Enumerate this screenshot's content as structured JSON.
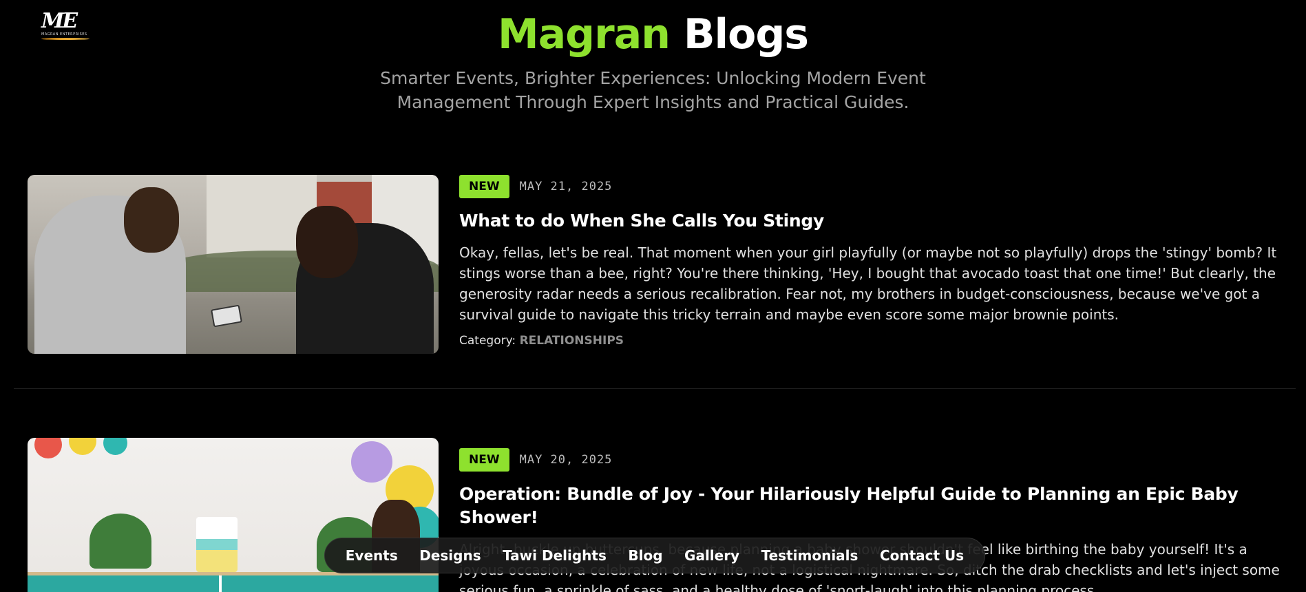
{
  "brand": {
    "logo_mark": "ME",
    "logo_subtext": "MAGRAN ENTERPRISES",
    "title_accent": "Magran",
    "title_rest": "Blogs",
    "tagline": "Smarter Events, Brighter Experiences: Unlocking Modern Event Management Through Expert Insights and Practical Guides.",
    "accent_color": "#8ee12e"
  },
  "posts": [
    {
      "badge": "NEW",
      "date": "MAY 21, 2025",
      "title": "What to do When She Calls You Stingy",
      "excerpt": "Okay, fellas, let's be real. That moment when your girl playfully (or maybe not so playfully) drops the 'stingy' bomb? It stings worse than a bee, right? You're there thinking, 'Hey, I bought that avocado toast that one time!' But clearly, the generosity radar needs a serious recalibration. Fear not, my brothers in budget-consciousness, because we've got a survival guide to navigate this tricky terrain and maybe even score some major brownie points.",
      "category_label": "Category:",
      "category_value": "RELATIONSHIPS"
    },
    {
      "badge": "NEW",
      "date": "MAY 20, 2025",
      "title": "Operation: Bundle of Joy - Your Hilariously Helpful Guide to Planning an Epic Baby Shower!",
      "excerpt": "Alright, buckle up buttercups, because planning a baby shower shouldn't feel like birthing the baby yourself! It's a joyous occasion, a celebration of new life, not a logistical nightmare. So, ditch the drab checklists and let's inject some serious fun, a sprinkle of sass, and a healthy dose of 'snort-laugh' into this planning process."
    }
  ],
  "nav": {
    "items": [
      "Events",
      "Designs",
      "Tawi Delights",
      "Blog",
      "Gallery",
      "Testimonials",
      "Contact Us"
    ]
  }
}
